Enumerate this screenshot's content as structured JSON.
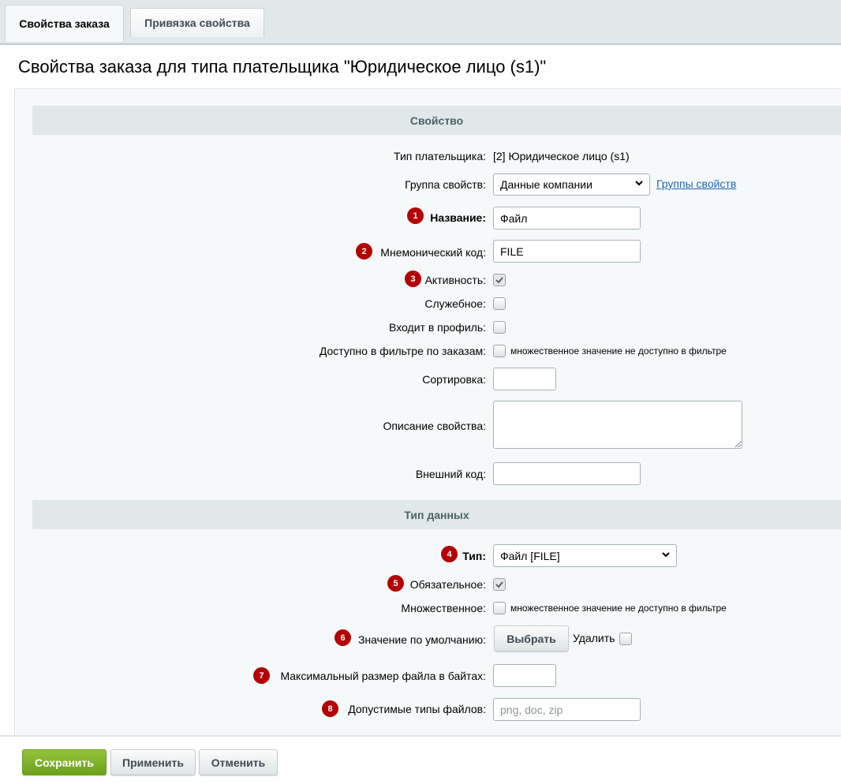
{
  "tabs": [
    {
      "label": "Свойства заказа"
    },
    {
      "label": "Привязка свойства"
    }
  ],
  "page_title": "Свойства заказа для типа плательщика \"Юридическое лицо (s1)\"",
  "sections": {
    "property": "Свойство",
    "data_type": "Тип данных"
  },
  "fields": {
    "payer_type": {
      "label": "Тип плательщика:",
      "value": "[2] Юридическое лицо (s1)"
    },
    "property_group": {
      "label": "Группа свойств:",
      "value": "Данные компании",
      "link": "Группы свойств"
    },
    "name": {
      "label": "Название:",
      "value": "Файл",
      "badge": "1"
    },
    "code": {
      "label": "Мнемонический код:",
      "value": "FILE",
      "badge": "2"
    },
    "active": {
      "label": "Активность:",
      "checked": true,
      "badge": "3"
    },
    "util": {
      "label": "Служебное:",
      "checked": false
    },
    "profile": {
      "label": "Входит в профиль:",
      "checked": false
    },
    "filter": {
      "label": "Доступно в фильтре по заказам:",
      "checked": false,
      "note": "множественное значение не доступно в фильтре"
    },
    "sort": {
      "label": "Сортировка:",
      "value": ""
    },
    "description": {
      "label": "Описание свойства:",
      "value": ""
    },
    "xml_id": {
      "label": "Внешний код:",
      "value": ""
    },
    "type": {
      "label": "Тип:",
      "value": "Файл [FILE]",
      "badge": "4"
    },
    "required": {
      "label": "Обязательное:",
      "checked": true,
      "badge": "5"
    },
    "multiple": {
      "label": "Множественное:",
      "checked": false,
      "note": "множественное значение не доступно в фильтре"
    },
    "default": {
      "label": "Значение по умолчанию:",
      "button": "Выбрать",
      "delete_label": "Удалить",
      "badge": "6"
    },
    "max_size": {
      "label": "Максимальный размер файла в байтах:",
      "value": "",
      "badge": "7"
    },
    "extensions": {
      "label": "Допустимые типы файлов:",
      "placeholder": "png, doc, zip",
      "badge": "8"
    }
  },
  "buttons": {
    "save": "Сохранить",
    "apply": "Применить",
    "cancel": "Отменить"
  },
  "colors": {
    "badge": "#b30000",
    "save_button": "#7db22a",
    "link": "#2067b0"
  }
}
